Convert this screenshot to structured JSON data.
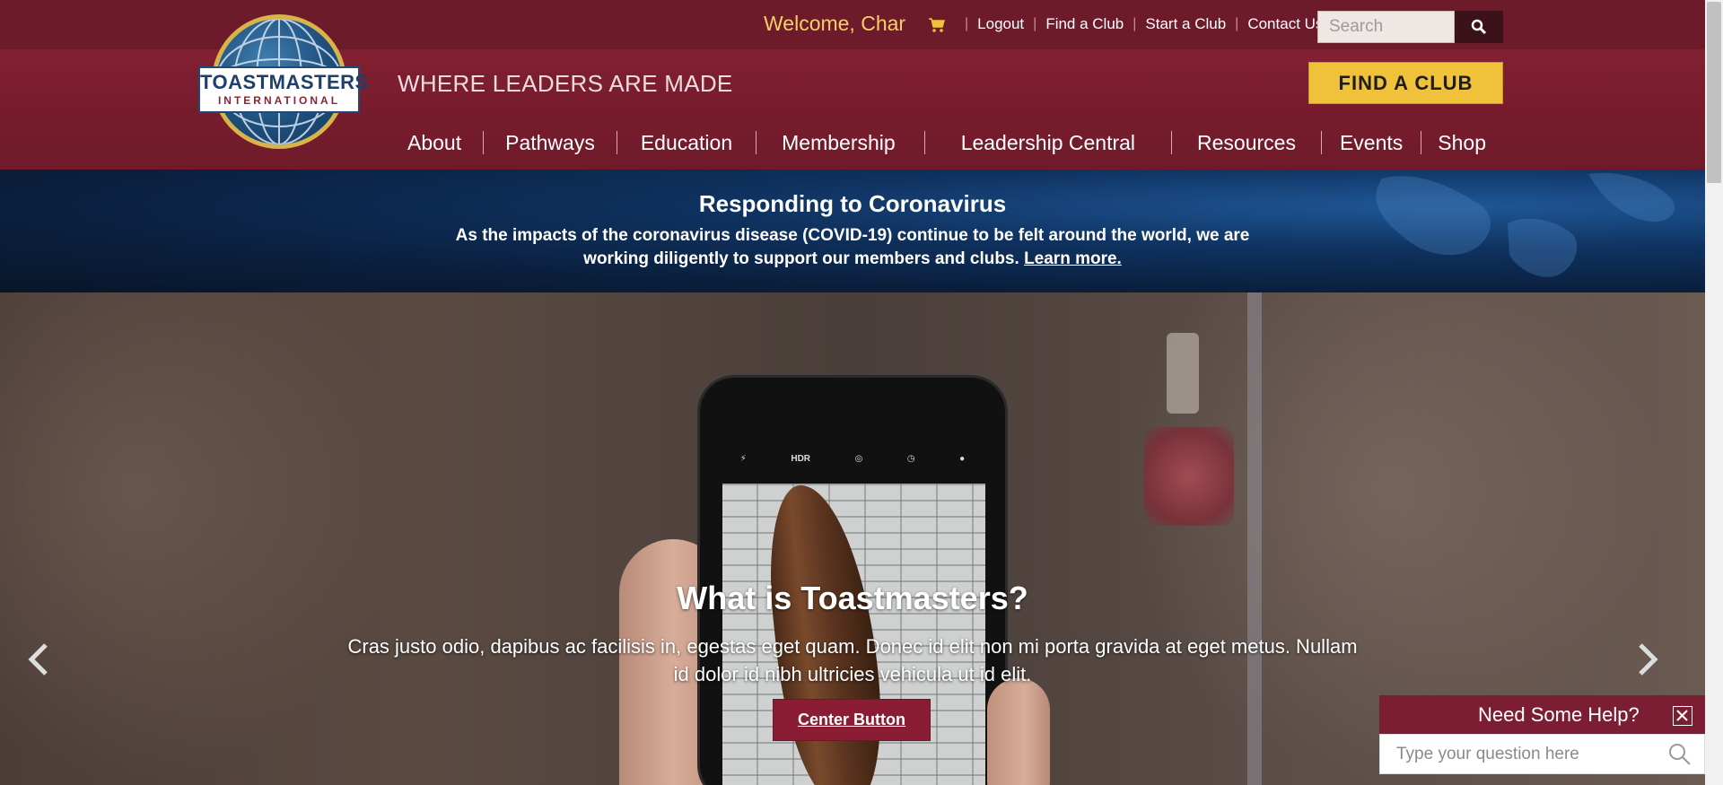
{
  "header": {
    "logo": {
      "line1": "TOASTMASTERS",
      "line2": "INTERNATIONAL"
    },
    "welcome": "Welcome, Char",
    "utility_links": [
      "Logout",
      "Find a Club",
      "Start a Club",
      "Contact Us"
    ],
    "search": {
      "placeholder": "Search"
    },
    "tagline": "WHERE LEADERS ARE MADE",
    "cta_label": "FIND A CLUB",
    "nav": [
      "About",
      "Pathways",
      "Education",
      "Membership",
      "Leadership Central",
      "Resources",
      "Events",
      "Shop"
    ]
  },
  "covid_banner": {
    "title": "Responding to Coronavirus",
    "text": "As the impacts of the coronavirus disease (COVID-19) continue to be felt around the world, we are working diligently to support our members and clubs.",
    "link_text": "Learn more."
  },
  "hero": {
    "phone_labels": [
      "HDR"
    ],
    "title": "What is Toastmasters?",
    "description": "Cras justo odio, dapibus ac facilisis in, egestas eget quam. Donec id elit non mi porta gravida at eget metus. Nullam id dolor id nibh ultricies vehicula ut id elit.",
    "button_label": "Center Button"
  },
  "help_widget": {
    "title": "Need Some Help?",
    "placeholder": "Type your question here"
  },
  "colors": {
    "brand_maroon": "#7b1e33",
    "cta_gold": "#f0c23b",
    "welcome_gold": "#f5d067",
    "banner_navy": "#0f3260"
  },
  "icons": [
    "cart-icon",
    "search-icon",
    "chevron-left-icon",
    "chevron-right-icon",
    "close-icon"
  ]
}
